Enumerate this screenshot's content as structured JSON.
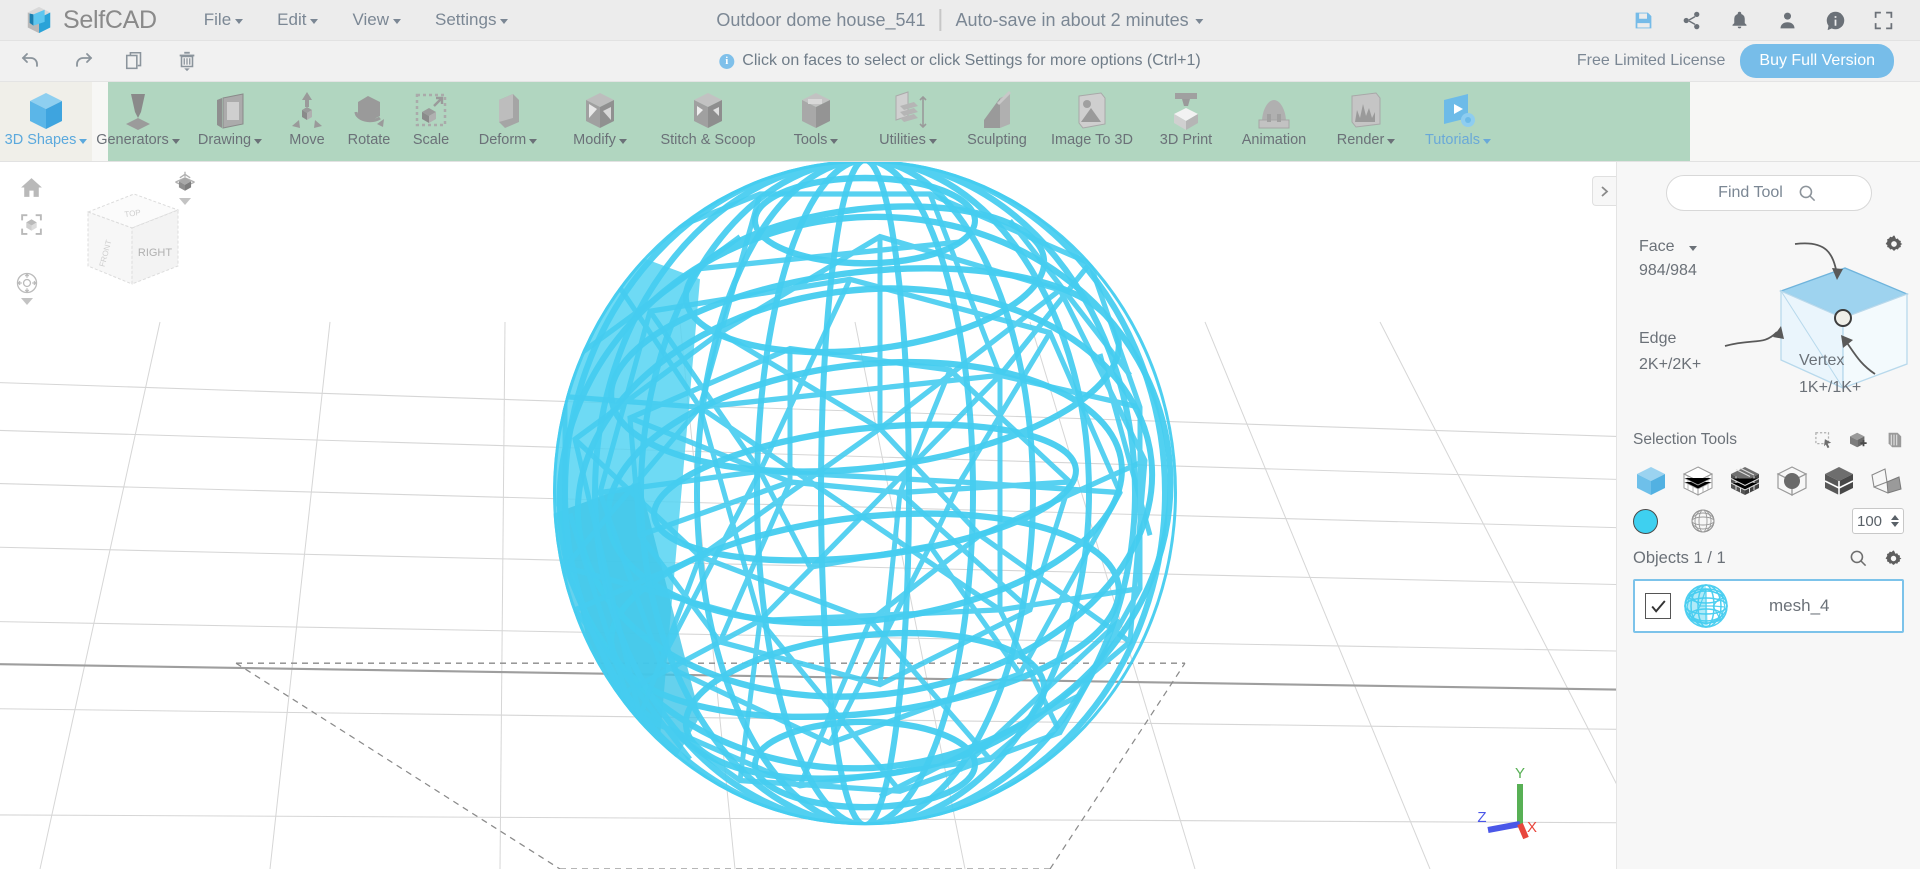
{
  "app": {
    "brand": "SelfCAD",
    "logo_icon": "selfcad-logo-icon"
  },
  "menubar": {
    "items": [
      {
        "label": "File",
        "has_caret": true
      },
      {
        "label": "Edit",
        "has_caret": true
      },
      {
        "label": "View",
        "has_caret": true
      },
      {
        "label": "Settings",
        "has_caret": true
      }
    ],
    "project_title": "Outdoor dome house_541",
    "autosave_text": "Auto-save in about 2 minutes",
    "icons": [
      {
        "name": "save-icon",
        "color": "#76bbe8"
      },
      {
        "name": "share-icon",
        "color": "#6b7178"
      },
      {
        "name": "notification-bell-icon",
        "color": "#6b7178"
      },
      {
        "name": "user-account-icon",
        "color": "#6b7178"
      },
      {
        "name": "info-icon",
        "color": "#6b7178"
      },
      {
        "name": "fullscreen-icon",
        "color": "#6b7178"
      }
    ]
  },
  "subbar": {
    "history_tools": [
      {
        "name": "undo-icon"
      },
      {
        "name": "redo-icon"
      },
      {
        "name": "copy-icon"
      },
      {
        "name": "delete-icon"
      }
    ],
    "hint_text": "Click on faces to select or click Settings for more options (Ctrl+1)",
    "license_text": "Free Limited License",
    "buy_label": "Buy Full Version"
  },
  "ribbon": {
    "items": [
      {
        "label": "3D Shapes",
        "icon": "cube-icon",
        "caret": true,
        "active": true
      },
      {
        "label": "Generators",
        "icon": "generator-icon",
        "caret": true,
        "active": false
      },
      {
        "label": "Drawing",
        "icon": "drawing-icon",
        "caret": true,
        "active": false
      },
      {
        "label": "Move",
        "icon": "move-icon",
        "caret": false,
        "active": false
      },
      {
        "label": "Rotate",
        "icon": "rotate-icon",
        "caret": false,
        "active": false
      },
      {
        "label": "Scale",
        "icon": "scale-icon",
        "caret": false,
        "active": false
      },
      {
        "label": "Deform",
        "icon": "deform-icon",
        "caret": true,
        "active": false
      },
      {
        "label": "Modify",
        "icon": "modify-icon",
        "caret": true,
        "active": false
      },
      {
        "label": "Stitch & Scoop",
        "icon": "stitch-scoop-icon",
        "caret": false,
        "active": false
      },
      {
        "label": "Tools",
        "icon": "tools-icon",
        "caret": true,
        "active": false
      },
      {
        "label": "Utilities",
        "icon": "utilities-icon",
        "caret": true,
        "active": false
      },
      {
        "label": "Sculpting",
        "icon": "sculpting-icon",
        "caret": false,
        "active": false
      },
      {
        "label": "Image To 3D",
        "icon": "image-to-3d-icon",
        "caret": false,
        "active": false
      },
      {
        "label": "3D Print",
        "icon": "3d-print-icon",
        "caret": false,
        "active": false
      },
      {
        "label": "Animation",
        "icon": "animation-icon",
        "caret": false,
        "active": false
      },
      {
        "label": "Render",
        "icon": "render-icon",
        "caret": true,
        "active": false
      },
      {
        "label": "Tutorials",
        "icon": "tutorials-icon",
        "caret": true,
        "active": false
      }
    ]
  },
  "viewport": {
    "tools": [
      {
        "name": "home-view-icon"
      },
      {
        "name": "fit-to-view-icon"
      }
    ],
    "nav_icon": "orbit-navigation-icon",
    "perspective_icon": "perspective-view-icon",
    "viewcube_face": "RIGHT",
    "viewcube_top": "TOP",
    "viewcube_left": "FRONT",
    "axes": {
      "x": "X",
      "y": "Y",
      "z": "Z",
      "x_color": "#e8463c",
      "y_color": "#58b055",
      "z_color": "#4a57e8"
    },
    "model_color": "#45cdf0",
    "panel_toggle_icon": "chevron-right-icon"
  },
  "right_panel": {
    "search": {
      "placeholder": "Find Tool",
      "icon": "search-icon"
    },
    "selection": {
      "mode_label": "Face",
      "face_count": "984/984",
      "edge_label": "Edge",
      "edge_count": "2K+/2K+",
      "vertex_label": "Vertex",
      "vertex_count": "1K+/1K+",
      "settings_icon": "gear-icon"
    },
    "selection_tools": {
      "label": "Selection Tools",
      "mini_icons": [
        {
          "name": "rectangle-select-icon"
        },
        {
          "name": "add-selection-icon"
        },
        {
          "name": "through-selection-icon"
        }
      ],
      "modes": [
        {
          "name": "select-object-icon",
          "active": true
        },
        {
          "name": "select-grid-icon",
          "active": false
        },
        {
          "name": "select-blocks-icon",
          "active": false
        },
        {
          "name": "select-sphere-icon",
          "active": false
        },
        {
          "name": "select-half-icon",
          "active": false
        },
        {
          "name": "select-plane-icon",
          "active": false
        }
      ],
      "color_swatch": "#3ed0f0",
      "texture_icon": "mesh-pattern-icon",
      "opacity_value": "100"
    },
    "objects": {
      "label": "Objects 1 / 1",
      "search_icon": "search-icon",
      "settings_icon": "gear-icon",
      "list": [
        {
          "name": "mesh_4",
          "checked": true,
          "thumbnail": "dome-mesh-thumbnail"
        }
      ]
    }
  }
}
